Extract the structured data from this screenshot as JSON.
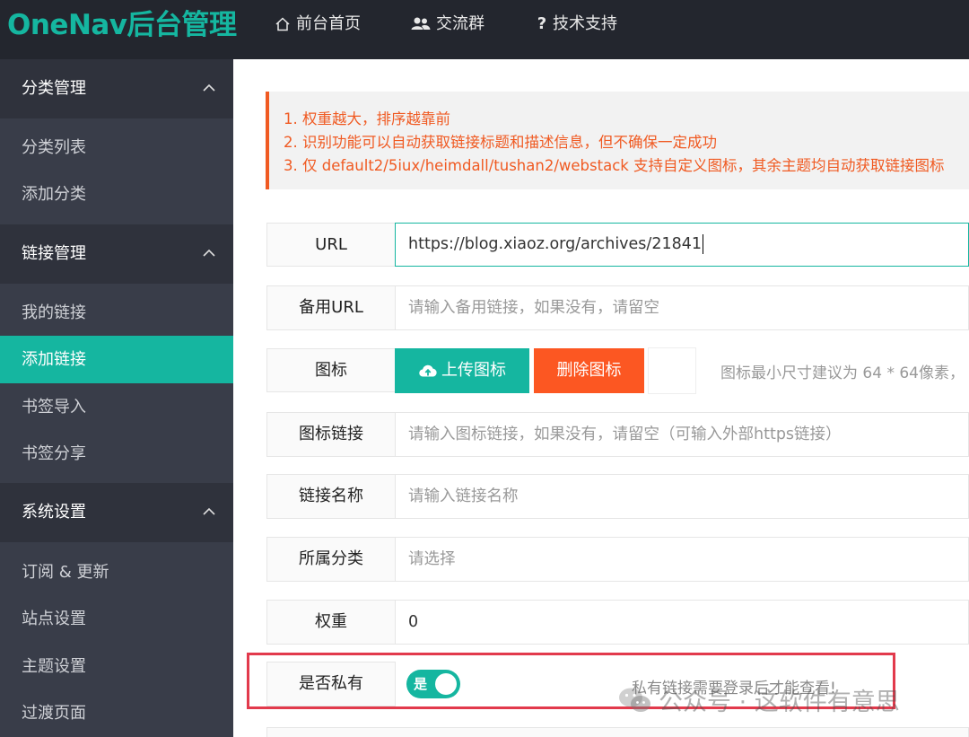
{
  "header": {
    "logo": "OneNav后台管理",
    "nav": [
      {
        "label": "前台首页",
        "icon": "home-icon"
      },
      {
        "label": "交流群",
        "icon": "users-icon"
      },
      {
        "label": "技术支持",
        "icon": "question-icon"
      }
    ]
  },
  "sidebar": {
    "groups": [
      {
        "label": "分类管理",
        "items": [
          "分类列表",
          "添加分类"
        ]
      },
      {
        "label": "链接管理",
        "items": [
          "我的链接",
          "添加链接",
          "书签导入",
          "书签分享"
        ]
      },
      {
        "label": "系统设置",
        "items": [
          "订阅 & 更新",
          "站点设置",
          "主题设置",
          "过渡页面"
        ]
      }
    ],
    "active_item": "添加链接"
  },
  "notice": [
    "1. 权重越大，排序越靠前",
    "2. 识别功能可以自动获取链接标题和描述信息，但不确保一定成功",
    "3. 仅 default2/5iux/heimdall/tushan2/webstack 支持自定义图标，其余主题均自动获取链接图标"
  ],
  "form": {
    "url": {
      "label": "URL",
      "value": "https://blog.xiaoz.org/archives/21841"
    },
    "backup_url": {
      "label": "备用URL",
      "placeholder": "请输入备用链接，如果没有，请留空"
    },
    "icon": {
      "label": "图标",
      "upload_label": "上传图标",
      "delete_label": "删除图标",
      "hint": "图标最小尺寸建议为 64 * 64像素，"
    },
    "icon_link": {
      "label": "图标链接",
      "placeholder": "请输入图标链接，如果没有，请留空（可输入外部https链接）"
    },
    "link_name": {
      "label": "链接名称",
      "placeholder": "请输入链接名称"
    },
    "category": {
      "label": "所属分类",
      "placeholder": "请选择"
    },
    "weight": {
      "label": "权重",
      "value": "0"
    },
    "private": {
      "label": "是否私有",
      "switch_text": "是",
      "enabled": true,
      "hint": "私有链接需要登录后才能查看!"
    }
  },
  "watermark": "公众号 · 这软件有意思",
  "colors": {
    "accent": "#15b6a0",
    "danger": "#fc5722",
    "header_bg": "#23262e",
    "sidebar_bg": "#393d49"
  }
}
